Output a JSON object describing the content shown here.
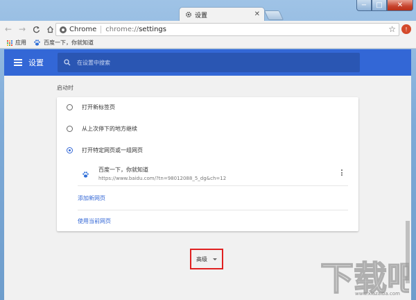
{
  "window": {
    "controls": {
      "minimize": "−",
      "maximize": "□",
      "close": "✕"
    }
  },
  "tab": {
    "title": "设置",
    "icon": "gear-icon",
    "close": "✕"
  },
  "toolbar": {
    "back_icon": "←",
    "forward_icon": "→",
    "reload_icon": "C",
    "home_icon": "⌂",
    "site_label": "Chrome",
    "url_scheme": "chrome://",
    "url_path": "settings",
    "star_icon": "☆",
    "profile_icon": "!"
  },
  "bookmarks": {
    "apps_label": "应用",
    "items": [
      {
        "label": "百度一下，你就知道",
        "icon": "paw-icon"
      }
    ],
    "app_colors": [
      "#e8453c",
      "#f9bb2d",
      "#3a7bd5",
      "#4ab85c",
      "#e8453c",
      "#3a7bd5",
      "#f9bb2d",
      "#4ab85c",
      "#e8453c"
    ]
  },
  "header": {
    "title": "设置",
    "search_placeholder": "在设置中搜索",
    "accent": "#3367d6"
  },
  "startup": {
    "section_label": "启动时",
    "options": [
      {
        "label": "打开新标签页",
        "checked": false
      },
      {
        "label": "从上次停下的地方继续",
        "checked": false
      },
      {
        "label": "打开特定网页或一组网页",
        "checked": true
      }
    ],
    "page": {
      "title": "百度一下，你就知道",
      "url": "https://www.baidu.com/?tn=98012088_5_dg&ch=12"
    },
    "add_page_link": "添加新网页",
    "use_current_link": "使用当前网页"
  },
  "advanced": {
    "label": "高级",
    "highlight": "#e02020"
  },
  "watermark": {
    "text": "下载吧",
    "sub": "www.xiazaiba.com"
  }
}
